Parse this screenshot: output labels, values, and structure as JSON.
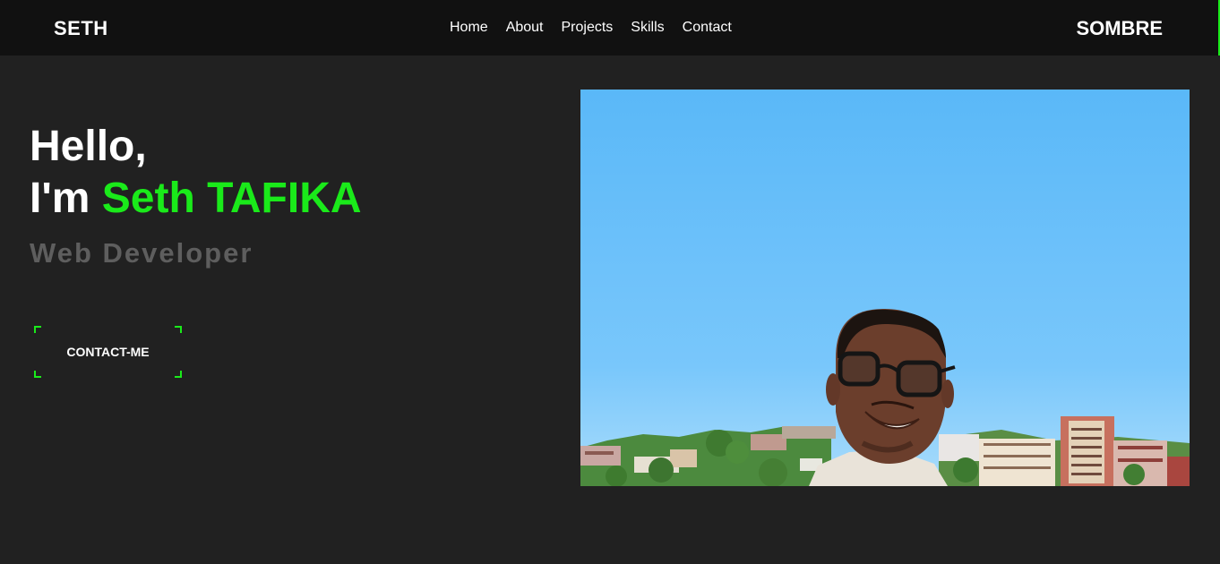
{
  "nav": {
    "brand": "SETH",
    "links": [
      "Home",
      "About",
      "Projects",
      "Skills",
      "Contact"
    ],
    "theme_toggle": "SOMBRE"
  },
  "hero": {
    "greeting": "Hello,",
    "intro_prefix": "I'm",
    "name": "Seth TAFIKA",
    "role": "Web Developer",
    "cta_label": "CONTACT-ME"
  },
  "colors": {
    "accent": "#1aea1a",
    "background": "#212121",
    "navbar": "#111111",
    "muted_text": "#5e5e5e"
  },
  "photo": {
    "subject": "portrait-photo",
    "description_icon": "person-with-glasses-city-background"
  }
}
